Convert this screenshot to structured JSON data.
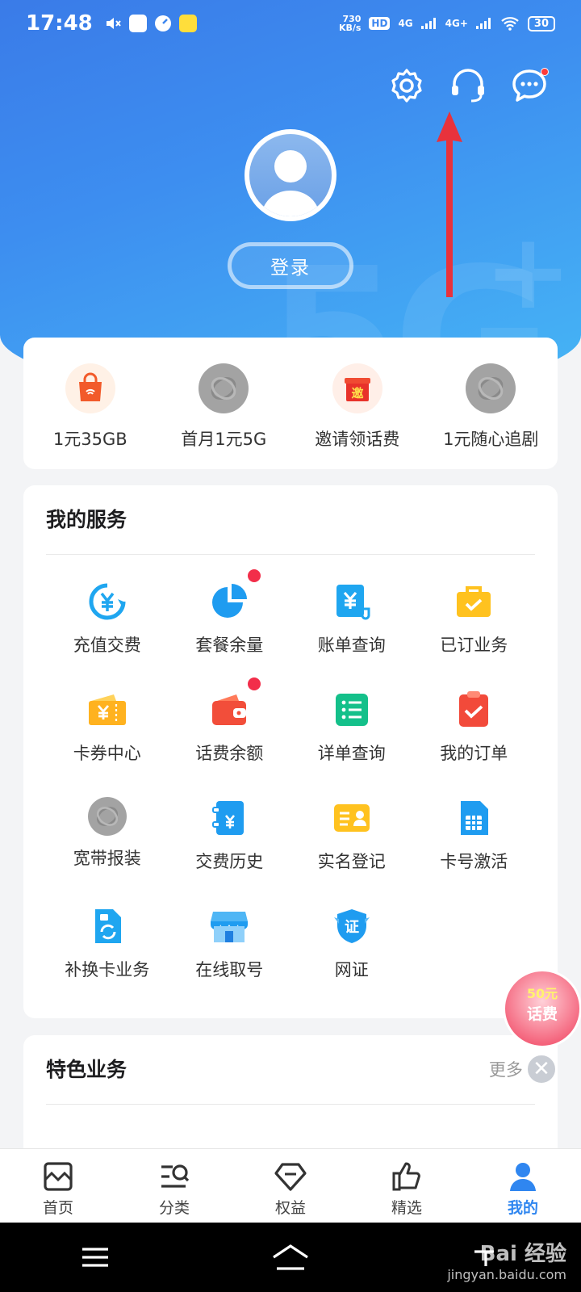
{
  "status_bar": {
    "time": "17:48",
    "speed_value": "730",
    "speed_unit": "KB/s",
    "hd": "HD",
    "network_1": "4G",
    "network_2": "4G+",
    "battery": "30"
  },
  "header": {
    "login_label": "登录",
    "deco_text": "5G",
    "deco_plus": "++"
  },
  "promo": [
    {
      "label": "1元35GB",
      "icon": "shopping-bag-icon",
      "color": "#f25a2a"
    },
    {
      "label": "首月1元5G",
      "icon": "china-mobile-logo-icon",
      "color": "#9a9a9a"
    },
    {
      "label": "邀请领话费",
      "icon": "gift-box-icon",
      "color": "#e8322a",
      "badge": "邀"
    },
    {
      "label": "1元随心追剧",
      "icon": "china-mobile-logo-icon",
      "color": "#9a9a9a"
    }
  ],
  "services": {
    "title": "我的服务",
    "items": [
      {
        "label": "充值交费",
        "icon": "recharge-yen-icon",
        "dot": false
      },
      {
        "label": "套餐余量",
        "icon": "pie-chart-icon",
        "dot": true
      },
      {
        "label": "账单查询",
        "icon": "bill-yen-icon",
        "dot": false
      },
      {
        "label": "已订业务",
        "icon": "briefcase-check-icon",
        "dot": false
      },
      {
        "label": "卡券中心",
        "icon": "coupon-icon",
        "dot": false
      },
      {
        "label": "话费余额",
        "icon": "wallet-icon",
        "dot": true
      },
      {
        "label": "详单查询",
        "icon": "list-icon",
        "dot": false
      },
      {
        "label": "我的订单",
        "icon": "clipboard-check-icon",
        "dot": false
      },
      {
        "label": "宽带报装",
        "icon": "china-mobile-logo-icon",
        "dot": false
      },
      {
        "label": "交费历史",
        "icon": "payment-history-icon",
        "dot": false
      },
      {
        "label": "实名登记",
        "icon": "id-card-icon",
        "dot": false
      },
      {
        "label": "卡号激活",
        "icon": "sim-card-icon",
        "dot": false
      },
      {
        "label": "补换卡业务",
        "icon": "sim-swap-icon",
        "dot": false
      },
      {
        "label": "在线取号",
        "icon": "store-icon",
        "dot": false
      },
      {
        "label": "网证",
        "icon": "certificate-shield-icon",
        "dot": false
      }
    ]
  },
  "featured": {
    "title": "特色业务",
    "more": "更多 ›"
  },
  "float_ad": {
    "line1": "50元",
    "line2": "话费",
    "close": "✕"
  },
  "tabbar": [
    {
      "label": "首页",
      "icon": "home-icon",
      "active": false
    },
    {
      "label": "分类",
      "icon": "category-search-icon",
      "active": false
    },
    {
      "label": "权益",
      "icon": "diamond-icon",
      "active": false
    },
    {
      "label": "精选",
      "icon": "thumbs-up-icon",
      "active": false
    },
    {
      "label": "我的",
      "icon": "user-icon",
      "active": true
    }
  ],
  "watermark": {
    "brand": "Bai 经验",
    "url": "jingyan.baidu.com"
  }
}
